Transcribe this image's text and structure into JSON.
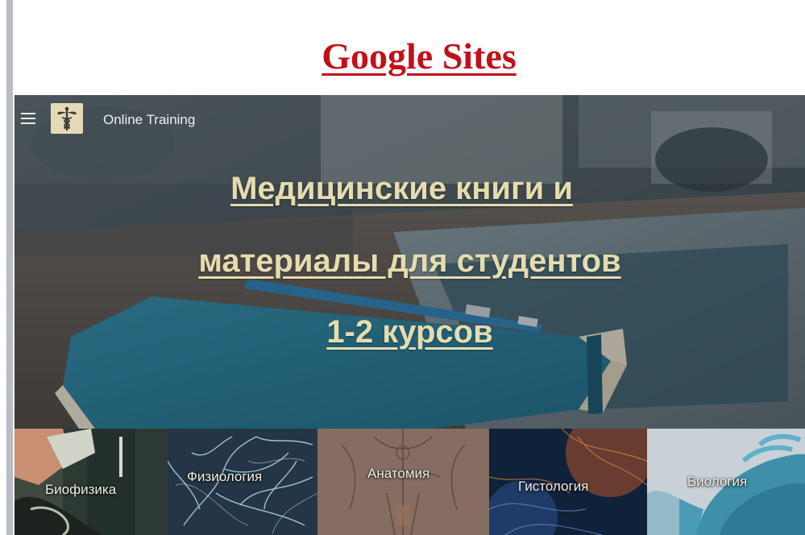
{
  "page": {
    "heading": "Google Sites"
  },
  "site": {
    "title": "Online Training",
    "menu_icon": "hamburger-menu-icon",
    "logo_icon": "caduceus-icon"
  },
  "hero": {
    "line1": "Медицинские книги и",
    "line2": "материалы для студентов ",
    "line3": "1-2 курсов"
  },
  "tiles": [
    {
      "label": "Биофизика"
    },
    {
      "label": "Физиология"
    },
    {
      "label": "Анатомия"
    },
    {
      "label": "Гистология"
    },
    {
      "label": "Биология"
    }
  ],
  "colors": {
    "heading": "#c0111b",
    "headline": "#e5dcaf",
    "logo_bg": "#e6d9b8"
  }
}
